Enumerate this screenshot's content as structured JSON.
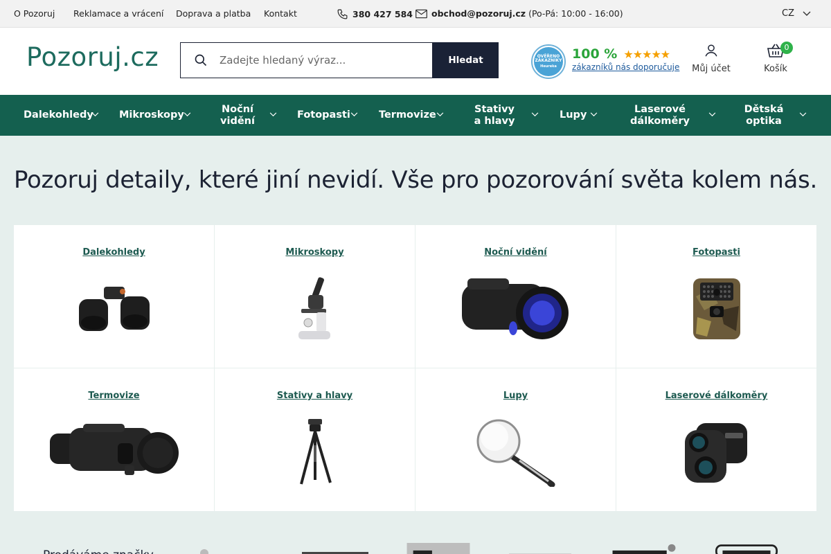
{
  "topbar": {
    "links": [
      "O Pozoruj",
      "Reklamace a vrácení",
      "Doprava a platba",
      "Kontakt"
    ],
    "phone": "380 427 584",
    "email": "obchod@pozoruj.cz",
    "hours": "(Po-Pá: 10:00 - 16:00)",
    "lang": "CZ"
  },
  "header": {
    "logo": "Pozoruj.cz",
    "search_placeholder": "Zadejte hledaný výraz...",
    "search_button": "Hledat",
    "badge_line1": "OVĚŘENO",
    "badge_line2": "ZÁKAZNÍKY",
    "badge_line3": "Heureka",
    "rating_pct": "100 %",
    "rating_stars": "★★★★★",
    "rating_text": "zákazníků nás doporučuje",
    "account_label": "Můj účet",
    "cart_label": "Košík",
    "cart_count": "0"
  },
  "nav": {
    "items": [
      {
        "label": "Dalekohledy"
      },
      {
        "label": "Mikroskopy"
      },
      {
        "label": "Noční vidění"
      },
      {
        "label": "Fotopasti"
      },
      {
        "label": "Termovize"
      },
      {
        "label": "Stativy a hlavy"
      },
      {
        "label": "Lupy"
      },
      {
        "label": "Laserové dálkoměry"
      },
      {
        "label": "Dětská optika"
      }
    ]
  },
  "hero": {
    "title": "Pozoruj detaily, které jiní nevidí. Vše pro pozorování světa kolem nás."
  },
  "categories": [
    {
      "label": "Dalekohledy",
      "icon": "binoculars-image"
    },
    {
      "label": "Mikroskopy",
      "icon": "microscope-image"
    },
    {
      "label": "Noční vidění",
      "icon": "night-vision-image"
    },
    {
      "label": "Fotopasti",
      "icon": "trail-camera-image"
    },
    {
      "label": "Termovize",
      "icon": "thermal-scope-image"
    },
    {
      "label": "Stativy a hlavy",
      "icon": "tripod-image"
    },
    {
      "label": "Lupy",
      "icon": "magnifier-image"
    },
    {
      "label": "Laserové dálkoměry",
      "icon": "rangefinder-image"
    }
  ],
  "brands": {
    "heading": "Prodáváme značky"
  },
  "colors": {
    "nav_bg": "#14604f",
    "accent_dark": "#1a2236",
    "brand_green": "#1d6b5e",
    "page_bg": "#e6efed"
  }
}
